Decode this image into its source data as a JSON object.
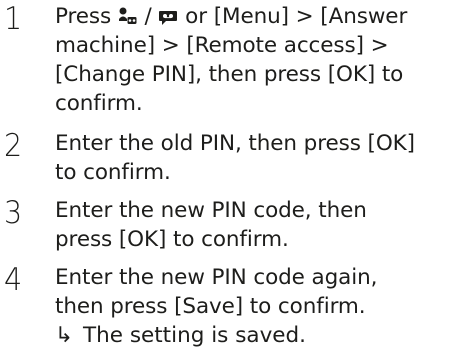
{
  "steps": [
    {
      "number": "1",
      "lines": [
        {
          "before": "Press ",
          "slash": " / ",
          "after": " or [Menu] > [Answer"
        },
        {
          "text": "machine] > [Remote access] >"
        },
        {
          "text": "[Change PIN], then press [OK] to"
        },
        {
          "text": "confirm."
        }
      ]
    },
    {
      "number": "2",
      "lines": [
        {
          "text": "Enter the old PIN, then press [OK]"
        },
        {
          "text": "to confirm."
        }
      ]
    },
    {
      "number": "3",
      "lines": [
        {
          "text": "Enter the new PIN code, then"
        },
        {
          "text": "press [OK] to confirm."
        }
      ]
    },
    {
      "number": "4",
      "lines": [
        {
          "text": "Enter the new PIN code again,"
        },
        {
          "text": "then press [Save] to confirm."
        }
      ],
      "result_arrow": "↳",
      "result": "The setting is saved."
    }
  ],
  "icons": {
    "first": "answering-machine-icon",
    "second": "voicemail-icon"
  }
}
